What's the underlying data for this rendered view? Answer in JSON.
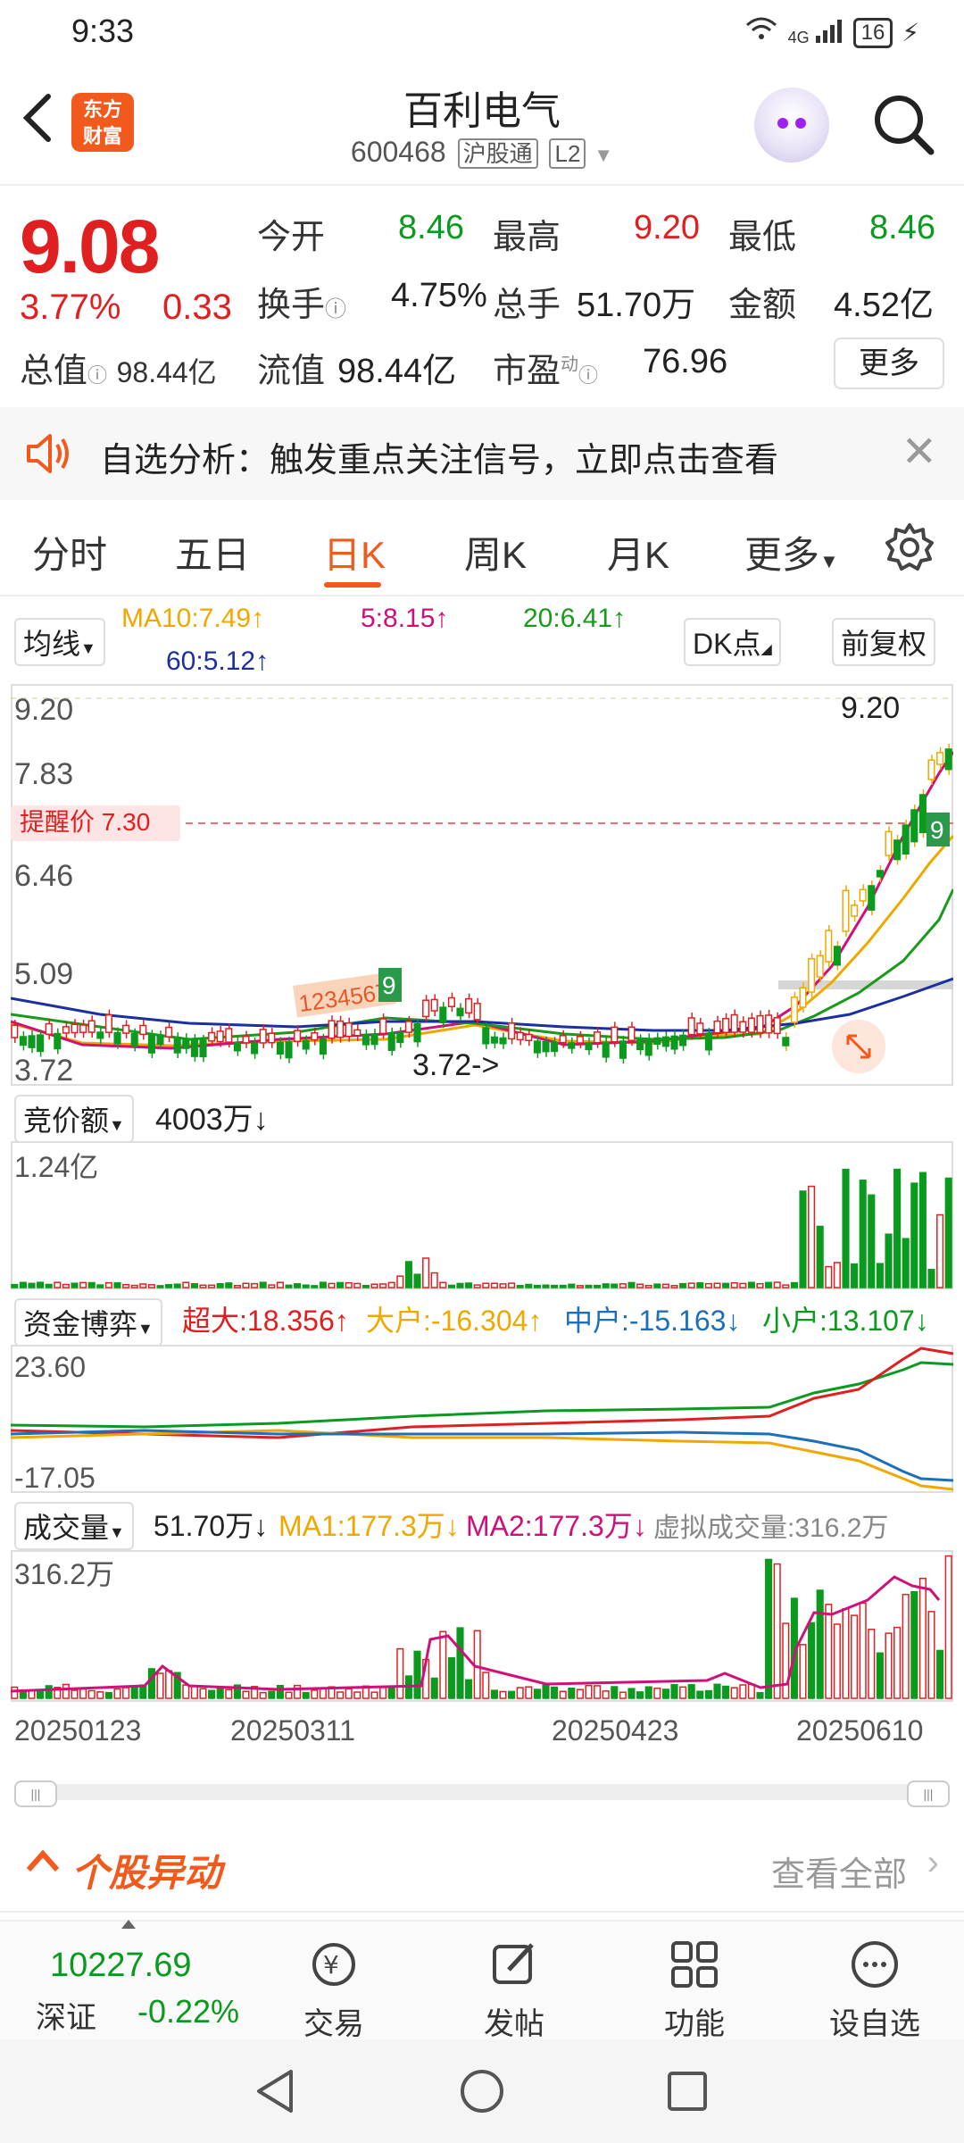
{
  "status_bar": {
    "time": "9:33",
    "signal": "4G",
    "battery": "16"
  },
  "header": {
    "stock_name": "百利电气",
    "stock_code": "600468",
    "tag_hk": "沪股通",
    "tag_level": "L2",
    "logo_text_1": "东方",
    "logo_text_2": "财富"
  },
  "quote": {
    "price": "9.08",
    "change_pct": "3.77%",
    "change_amt": "0.33",
    "open_label": "今开",
    "open": "8.46",
    "high_label": "最高",
    "high": "9.20",
    "low_label": "最低",
    "low": "8.46",
    "turnover_label": "换手",
    "turnover": "4.75%",
    "volume_label": "总手",
    "volume": "51.70万",
    "amount_label": "金额",
    "amount": "4.52亿",
    "mktcap_label": "总值",
    "mktcap": "98.44亿",
    "float_label": "流值",
    "float_cap": "98.44亿",
    "pe_label": "市盈",
    "pe_sup": "动",
    "pe": "76.96",
    "more_label": "更多"
  },
  "alert": {
    "text": "自选分析：触发重点关注信号，立即点击查看"
  },
  "tabs": [
    "分时",
    "五日",
    "日K",
    "周K",
    "月K",
    "更多"
  ],
  "kline": {
    "selector": "均线",
    "ma10": "MA10:7.49↑",
    "ma5": "5:8.15↑",
    "ma20": "20:6.41↑",
    "ma60": "60:5.12↑",
    "dk_button": "DK点",
    "adjust_button": "前复权",
    "y_labels": [
      "9.20",
      "7.83",
      "6.46",
      "5.09",
      "3.72"
    ],
    "reminder": "提醒价 7.30",
    "high_marker": "9.20",
    "low_marker": "3.72->",
    "counter_left": "12345678",
    "counter_left_badge": "9",
    "counter_right_badge": "9"
  },
  "auction": {
    "selector": "竞价额",
    "value": "4003万↓",
    "y_max": "1.24亿"
  },
  "fund": {
    "selector": "资金博弈",
    "super": "超大:18.356↑",
    "large": "大户:-16.304↑",
    "mid": "中户:-15.163↓",
    "small": "小户:13.107↓",
    "y_max": "23.60",
    "y_min": "-17.05"
  },
  "volume": {
    "selector": "成交量",
    "value": "51.70万↓",
    "ma1": "MA1:177.3万↓",
    "ma2": "MA2:177.3万↓",
    "virtual": "虚拟成交量:316.2万",
    "y_max": "316.2万"
  },
  "dates": [
    "20250123",
    "20250311",
    "20250423",
    "20250610"
  ],
  "movement": {
    "title": "个股异动",
    "view_all": "查看全部"
  },
  "bottom_nav": {
    "index_value": "10227.69",
    "index_name": "深证",
    "index_change": "-0.22%",
    "items": [
      "交易",
      "发帖",
      "功能",
      "设自选"
    ]
  },
  "colors": {
    "up": "#e02020",
    "down": "#0a9a1e",
    "accent": "#f25a1d",
    "ma10": "#f0a800",
    "ma5": "#d0107a",
    "ma20": "#1a9a1a",
    "ma60": "#1c2fa0"
  }
}
